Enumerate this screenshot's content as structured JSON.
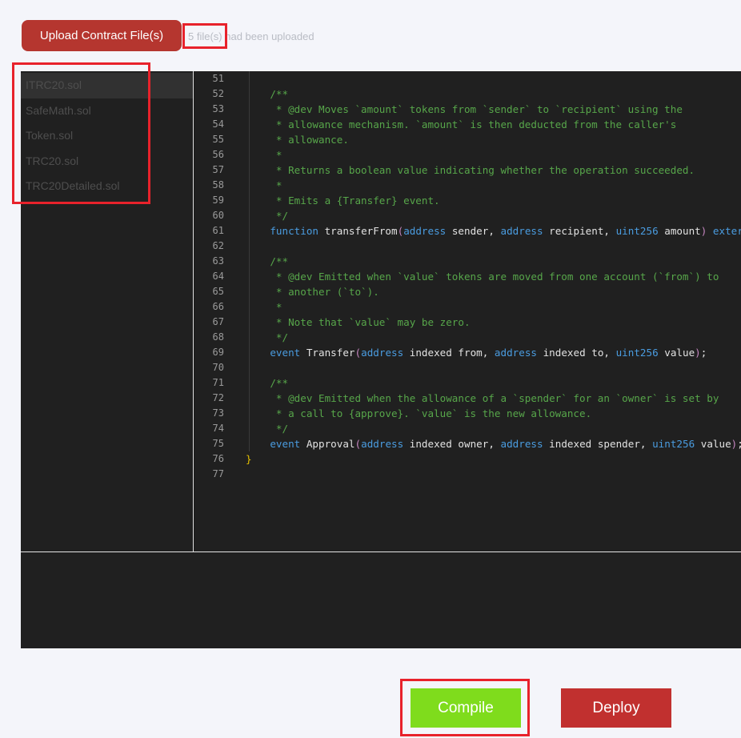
{
  "toolbar": {
    "upload_label": "Upload Contract File(s)",
    "upload_count": "5 file(s)",
    "upload_status_suffix": " had been uploaded"
  },
  "files": [
    {
      "name": "ITRC20.sol",
      "active": true
    },
    {
      "name": "SafeMath.sol",
      "active": false
    },
    {
      "name": "Token.sol",
      "active": false
    },
    {
      "name": "TRC20.sol",
      "active": false
    },
    {
      "name": "TRC20Detailed.sol",
      "active": false
    }
  ],
  "colors": {
    "comment": "#57a64a",
    "keyword": "#4a9ce0",
    "plain": "#e2e2e2",
    "brace": "#e5c000",
    "paren": "#c586c0",
    "compile": "#7fdc1c",
    "deploy": "#c1302f",
    "upload": "#b5362f",
    "highlight": "#e8222b"
  },
  "code_lines": [
    {
      "n": "51",
      "guide": true,
      "tokens": []
    },
    {
      "n": "52",
      "guide": true,
      "tokens": [
        {
          "t": "    /**",
          "c": "comment"
        }
      ]
    },
    {
      "n": "53",
      "guide": true,
      "tokens": [
        {
          "t": "     * @dev Moves `amount` tokens from `sender` to `recipient` using the",
          "c": "comment"
        }
      ]
    },
    {
      "n": "54",
      "guide": true,
      "tokens": [
        {
          "t": "     * allowance mechanism. `amount` is then deducted from the caller's",
          "c": "comment"
        }
      ]
    },
    {
      "n": "55",
      "guide": true,
      "tokens": [
        {
          "t": "     * allowance.",
          "c": "comment"
        }
      ]
    },
    {
      "n": "56",
      "guide": true,
      "tokens": [
        {
          "t": "     *",
          "c": "comment"
        }
      ]
    },
    {
      "n": "57",
      "guide": true,
      "tokens": [
        {
          "t": "     * Returns a boolean value indicating whether the operation succeeded.",
          "c": "comment"
        }
      ]
    },
    {
      "n": "58",
      "guide": true,
      "tokens": [
        {
          "t": "     *",
          "c": "comment"
        }
      ]
    },
    {
      "n": "59",
      "guide": true,
      "tokens": [
        {
          "t": "     * Emits a {Transfer} event.",
          "c": "comment"
        }
      ]
    },
    {
      "n": "60",
      "guide": true,
      "tokens": [
        {
          "t": "     */",
          "c": "comment"
        }
      ]
    },
    {
      "n": "61",
      "guide": true,
      "tokens": [
        {
          "t": "    ",
          "c": "plain"
        },
        {
          "t": "function",
          "c": "keyword"
        },
        {
          "t": " transferFrom",
          "c": "plain"
        },
        {
          "t": "(",
          "c": "paren"
        },
        {
          "t": "address",
          "c": "keyword"
        },
        {
          "t": " sender, ",
          "c": "plain"
        },
        {
          "t": "address",
          "c": "keyword"
        },
        {
          "t": " recipient, ",
          "c": "plain"
        },
        {
          "t": "uint256",
          "c": "keyword"
        },
        {
          "t": " amount",
          "c": "plain"
        },
        {
          "t": ")",
          "c": "paren"
        },
        {
          "t": " external",
          "c": "keyword"
        }
      ]
    },
    {
      "n": "62",
      "guide": true,
      "tokens": []
    },
    {
      "n": "63",
      "guide": true,
      "tokens": [
        {
          "t": "    /**",
          "c": "comment"
        }
      ]
    },
    {
      "n": "64",
      "guide": true,
      "tokens": [
        {
          "t": "     * @dev Emitted when `value` tokens are moved from one account (`from`) to",
          "c": "comment"
        }
      ]
    },
    {
      "n": "65",
      "guide": true,
      "tokens": [
        {
          "t": "     * another (`to`).",
          "c": "comment"
        }
      ]
    },
    {
      "n": "66",
      "guide": true,
      "tokens": [
        {
          "t": "     *",
          "c": "comment"
        }
      ]
    },
    {
      "n": "67",
      "guide": true,
      "tokens": [
        {
          "t": "     * Note that `value` may be zero.",
          "c": "comment"
        }
      ]
    },
    {
      "n": "68",
      "guide": true,
      "tokens": [
        {
          "t": "     */",
          "c": "comment"
        }
      ]
    },
    {
      "n": "69",
      "guide": true,
      "tokens": [
        {
          "t": "    ",
          "c": "plain"
        },
        {
          "t": "event",
          "c": "keyword"
        },
        {
          "t": " Transfer",
          "c": "plain"
        },
        {
          "t": "(",
          "c": "paren"
        },
        {
          "t": "address",
          "c": "keyword"
        },
        {
          "t": " indexed from, ",
          "c": "plain"
        },
        {
          "t": "address",
          "c": "keyword"
        },
        {
          "t": " indexed to, ",
          "c": "plain"
        },
        {
          "t": "uint256",
          "c": "keyword"
        },
        {
          "t": " value",
          "c": "plain"
        },
        {
          "t": ")",
          "c": "paren"
        },
        {
          "t": ";",
          "c": "plain"
        }
      ]
    },
    {
      "n": "70",
      "guide": true,
      "tokens": []
    },
    {
      "n": "71",
      "guide": true,
      "tokens": [
        {
          "t": "    /**",
          "c": "comment"
        }
      ]
    },
    {
      "n": "72",
      "guide": true,
      "tokens": [
        {
          "t": "     * @dev Emitted when the allowance of a `spender` for an `owner` is set by",
          "c": "comment"
        }
      ]
    },
    {
      "n": "73",
      "guide": true,
      "tokens": [
        {
          "t": "     * a call to {approve}. `value` is the new allowance.",
          "c": "comment"
        }
      ]
    },
    {
      "n": "74",
      "guide": true,
      "tokens": [
        {
          "t": "     */",
          "c": "comment"
        }
      ]
    },
    {
      "n": "75",
      "guide": true,
      "tokens": [
        {
          "t": "    ",
          "c": "plain"
        },
        {
          "t": "event",
          "c": "keyword"
        },
        {
          "t": " Approval",
          "c": "plain"
        },
        {
          "t": "(",
          "c": "paren"
        },
        {
          "t": "address",
          "c": "keyword"
        },
        {
          "t": " indexed owner, ",
          "c": "plain"
        },
        {
          "t": "address",
          "c": "keyword"
        },
        {
          "t": " indexed spender, ",
          "c": "plain"
        },
        {
          "t": "uint256",
          "c": "keyword"
        },
        {
          "t": " value",
          "c": "plain"
        },
        {
          "t": ")",
          "c": "paren"
        },
        {
          "t": ";",
          "c": "plain"
        }
      ]
    },
    {
      "n": "76",
      "guide": false,
      "tokens": [
        {
          "t": "}",
          "c": "brace"
        }
      ]
    },
    {
      "n": "77",
      "guide": false,
      "tokens": []
    }
  ],
  "actions": {
    "compile_label": "Compile",
    "deploy_label": "Deploy"
  }
}
